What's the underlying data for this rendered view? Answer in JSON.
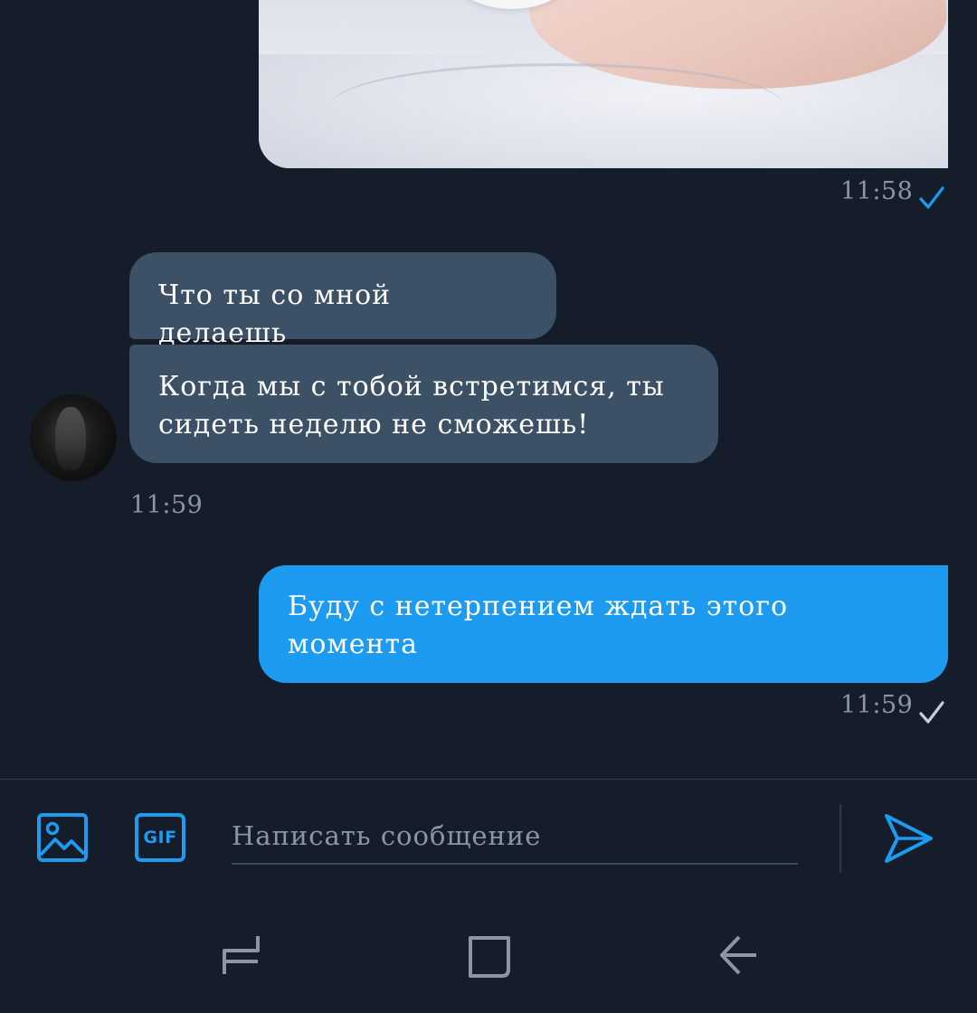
{
  "conversation": {
    "messages": [
      {
        "id": "m1",
        "direction": "outgoing",
        "type": "image",
        "time": "11:58",
        "status": "read"
      },
      {
        "id": "m2",
        "direction": "incoming",
        "type": "text",
        "text": "Что ты со мной делаешь"
      },
      {
        "id": "m3",
        "direction": "incoming",
        "type": "text",
        "text_lines": [
          "Когда мы с тобой встретимся, ты",
          "сидеть неделю не сможешь!"
        ],
        "time": "11:59"
      },
      {
        "id": "m4",
        "direction": "outgoing",
        "type": "text",
        "text_lines": [
          "Буду с нетерпением ждать этого",
          "момента"
        ],
        "time": "11:59",
        "status": "sent"
      }
    ]
  },
  "composer": {
    "placeholder": "Написать сообщение",
    "value": "",
    "gif_label": "GIF",
    "icons": {
      "media": "image-icon",
      "gif": "gif-icon",
      "send": "send-icon"
    }
  },
  "navbar": {
    "icons": [
      "recent-apps-icon",
      "home-icon",
      "back-icon"
    ]
  },
  "colors": {
    "background": "#151d2b",
    "incoming_bubble": "#3c5066",
    "outgoing_bubble": "#1d9bf0",
    "accent": "#1d9bf0",
    "muted_text": "#8a96a6",
    "read_check": "#1d9bf0",
    "sent_check": "#c8ced6"
  }
}
